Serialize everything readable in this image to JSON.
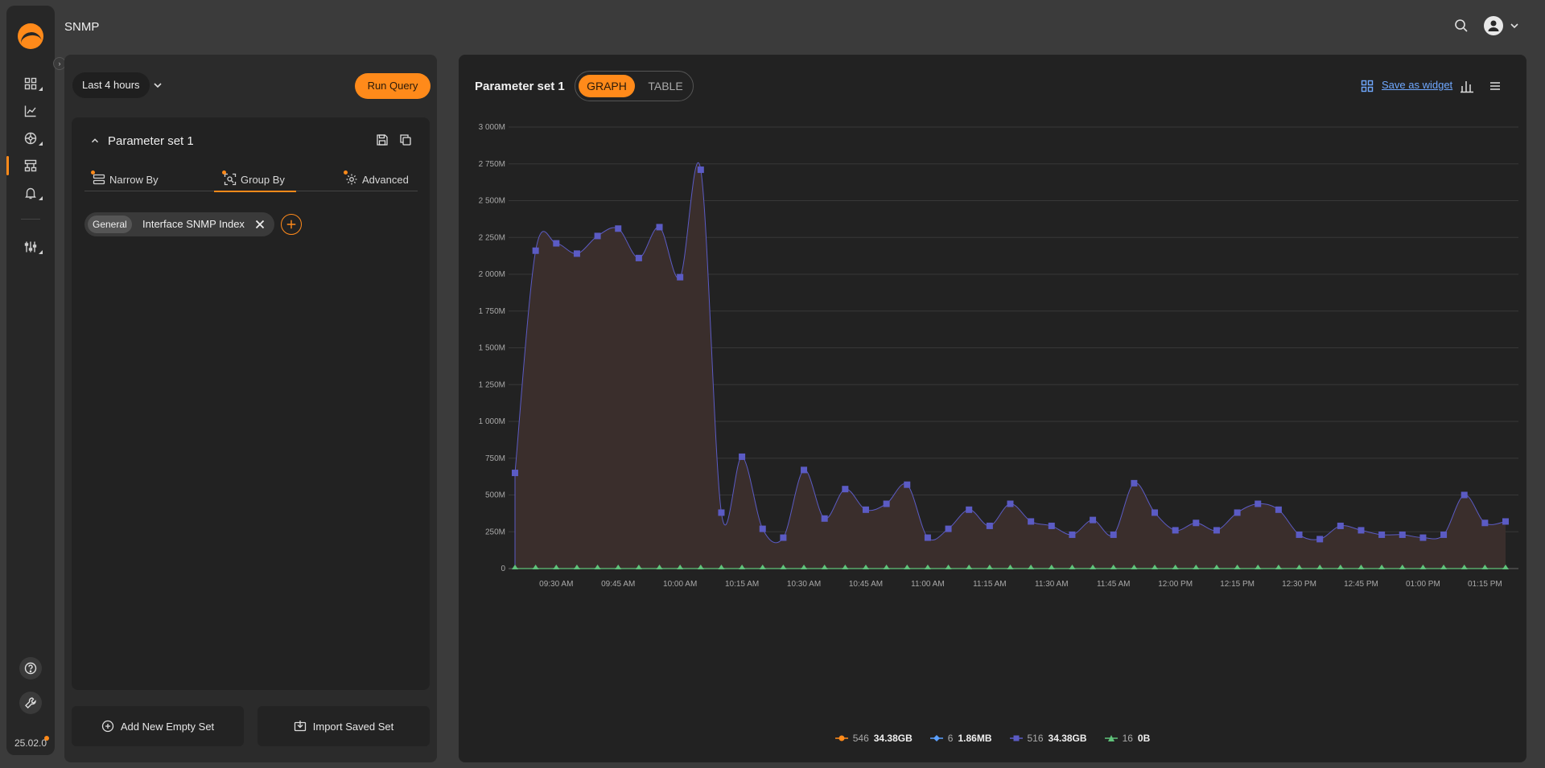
{
  "app": {
    "page_title": "SNMP",
    "version": "25.02.0"
  },
  "sidebar": {
    "items": [
      {
        "icon": "dashboard-icon"
      },
      {
        "icon": "chart-line-icon"
      },
      {
        "icon": "network-icon"
      },
      {
        "icon": "hierarchy-icon"
      },
      {
        "icon": "bell-icon"
      },
      {
        "icon": "sliders-icon"
      }
    ],
    "help_icon": "help-icon",
    "wrench_icon": "wrench-icon"
  },
  "query": {
    "time_range": "Last 4 hours",
    "run_label": "Run Query"
  },
  "parameter_set": {
    "title": "Parameter set 1",
    "tabs": [
      {
        "label": "Narrow By",
        "icon": "narrow-by-icon"
      },
      {
        "label": "Group By",
        "icon": "group-by-icon"
      },
      {
        "label": "Advanced",
        "icon": "gear-icon"
      }
    ],
    "active_tab": "Group By",
    "chip": {
      "category": "General",
      "value": "Interface SNMP Index"
    }
  },
  "actions": {
    "add_set": "Add New Empty Set",
    "import_set": "Import Saved Set"
  },
  "chart_panel": {
    "title": "Parameter set 1",
    "view_graph": "GRAPH",
    "view_table": "TABLE",
    "active_view": "GRAPH",
    "save_widget": "Save as widget"
  },
  "colors": {
    "accent": "#ff8a1a",
    "series_main": "#5b5bc4",
    "series_green": "#5fc27a",
    "series_blue": "#5aa0ff",
    "area_fill": "#3a2e2c"
  },
  "chart_data": {
    "type": "area",
    "ylim": [
      0,
      3000
    ],
    "y_ticks": [
      "0",
      "250M",
      "500M",
      "750M",
      "1 000M",
      "1 250M",
      "1 500M",
      "1 750M",
      "2 000M",
      "2 250M",
      "2 500M",
      "2 750M",
      "3 000M"
    ],
    "x_ticks": [
      "09:30 AM",
      "09:45 AM",
      "10:00 AM",
      "10:15 AM",
      "10:30 AM",
      "10:45 AM",
      "11:00 AM",
      "11:15 AM",
      "11:30 AM",
      "11:45 AM",
      "12:00 PM",
      "12:15 PM",
      "12:30 PM",
      "12:45 PM",
      "01:00 PM",
      "01:15 PM"
    ],
    "series": [
      {
        "name": "546",
        "total": "34.38GB",
        "marker": "circle"
      },
      {
        "name": "6",
        "total": "1.86MB",
        "marker": "diamond"
      },
      {
        "name": "516",
        "total": "34.38GB",
        "marker": "square",
        "values": [
          650,
          2160,
          2210,
          2140,
          2260,
          2310,
          2110,
          2320,
          1980,
          2710,
          380,
          760,
          270,
          210,
          670,
          340,
          540,
          400,
          440,
          570,
          210,
          270,
          400,
          290,
          440,
          320,
          290,
          230,
          330,
          230,
          580,
          380,
          260,
          310,
          260,
          380,
          440,
          400,
          230,
          200,
          290,
          260,
          230,
          230,
          210,
          230,
          500,
          310,
          320
        ]
      },
      {
        "name": "16",
        "total": "0B",
        "marker": "triangle",
        "values": [
          0,
          0,
          0,
          0,
          0,
          0,
          0,
          0,
          0,
          0,
          0,
          0,
          0,
          0,
          0,
          0,
          0,
          0,
          0,
          0,
          0,
          0,
          0,
          0,
          0,
          0,
          0,
          0,
          0,
          0,
          0,
          0,
          0,
          0,
          0,
          0,
          0,
          0,
          0,
          0,
          0,
          0,
          0,
          0,
          0,
          0,
          0,
          0,
          0
        ]
      }
    ]
  }
}
